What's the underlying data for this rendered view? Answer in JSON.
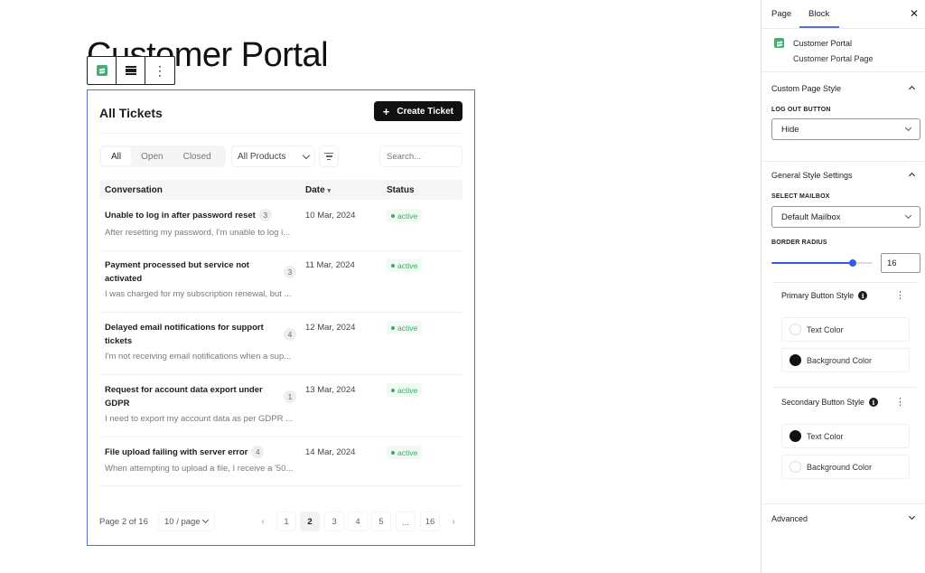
{
  "page": {
    "title": "Customer Portal"
  },
  "block_toolbar": {
    "items": [
      {
        "icon": "fluent-support-logo-icon"
      },
      {
        "icon": "align-icon"
      },
      {
        "icon": "more-options-icon",
        "glyph": "⋮"
      }
    ]
  },
  "portal": {
    "title": "All Tickets",
    "create_button": {
      "icon": "+",
      "label": "Create Ticket"
    },
    "filters": {
      "segments": [
        "All",
        "Open",
        "Closed"
      ],
      "active_segment": "All",
      "product_select": "All Products",
      "search_placeholder": "Search..."
    },
    "columns": {
      "conversation": "Conversation",
      "date": "Date",
      "date_sort": "▾",
      "status": "Status"
    },
    "tickets": [
      {
        "subject": "Unable to log in after password reset",
        "count": "3",
        "excerpt": "After resetting my password, I'm unable to log i...",
        "date": "10 Mar, 2024",
        "status": "active"
      },
      {
        "subject": "Payment processed but service not activated",
        "count": "3",
        "excerpt": "I was charged for my subscription renewal, but ...",
        "date": "11 Mar, 2024",
        "status": "active"
      },
      {
        "subject": "Delayed email notifications for support tickets",
        "count": "4",
        "excerpt": "I'm not receiving email notifications when a sup...",
        "date": "12 Mar, 2024",
        "status": "active"
      },
      {
        "subject": "Request for account data export under GDPR",
        "count": "1",
        "excerpt": "I need to export my account data as per GDPR ...",
        "date": "13 Mar, 2024",
        "status": "active"
      },
      {
        "subject": "File upload failing with server error",
        "count": "4",
        "excerpt": "When attempting to upload a file, I receive a '50...",
        "date": "14 Mar, 2024",
        "status": "active"
      }
    ],
    "pagination": {
      "info": "Page 2 of 16",
      "per_page": "10 / page",
      "prev": "‹",
      "next": "›",
      "pages": [
        "1",
        "2",
        "3",
        "4",
        "5",
        "...",
        "16"
      ],
      "current": "2"
    }
  },
  "sidebar": {
    "tabs": [
      "Page",
      "Block"
    ],
    "active_tab": "Block",
    "close": "✕",
    "block": {
      "name": "Customer Portal",
      "description": "Customer Portal Page"
    },
    "custom_page_style": {
      "title": "Custom Page Style",
      "logout_label": "LOG OUT BUTTON",
      "logout_value": "Hide"
    },
    "general_style": {
      "title": "General Style Settings",
      "mailbox_label": "SELECT MAILBOX",
      "mailbox_value": "Default Mailbox",
      "radius_label": "BORDER RADIUS",
      "radius_value": "16",
      "radius_slider_fraction": 0.8
    },
    "primary_button_style": {
      "title": "Primary Button Style",
      "info": "i",
      "rows": [
        {
          "label": "Text Color",
          "swatch": "#ffffff"
        },
        {
          "label": "Background Color",
          "swatch": "#111111"
        }
      ]
    },
    "secondary_button_style": {
      "title": "Secondary Button Style",
      "info": "i",
      "rows": [
        {
          "label": "Text Color",
          "swatch": "#111111"
        },
        {
          "label": "Background Color",
          "swatch": "#ffffff"
        }
      ]
    },
    "advanced": {
      "title": "Advanced"
    }
  },
  "colors": {
    "accent": "#3858e9",
    "selection_outline": "#5b6fd0",
    "brand_green": "#3fb072",
    "status_active": "#3fa76a"
  }
}
